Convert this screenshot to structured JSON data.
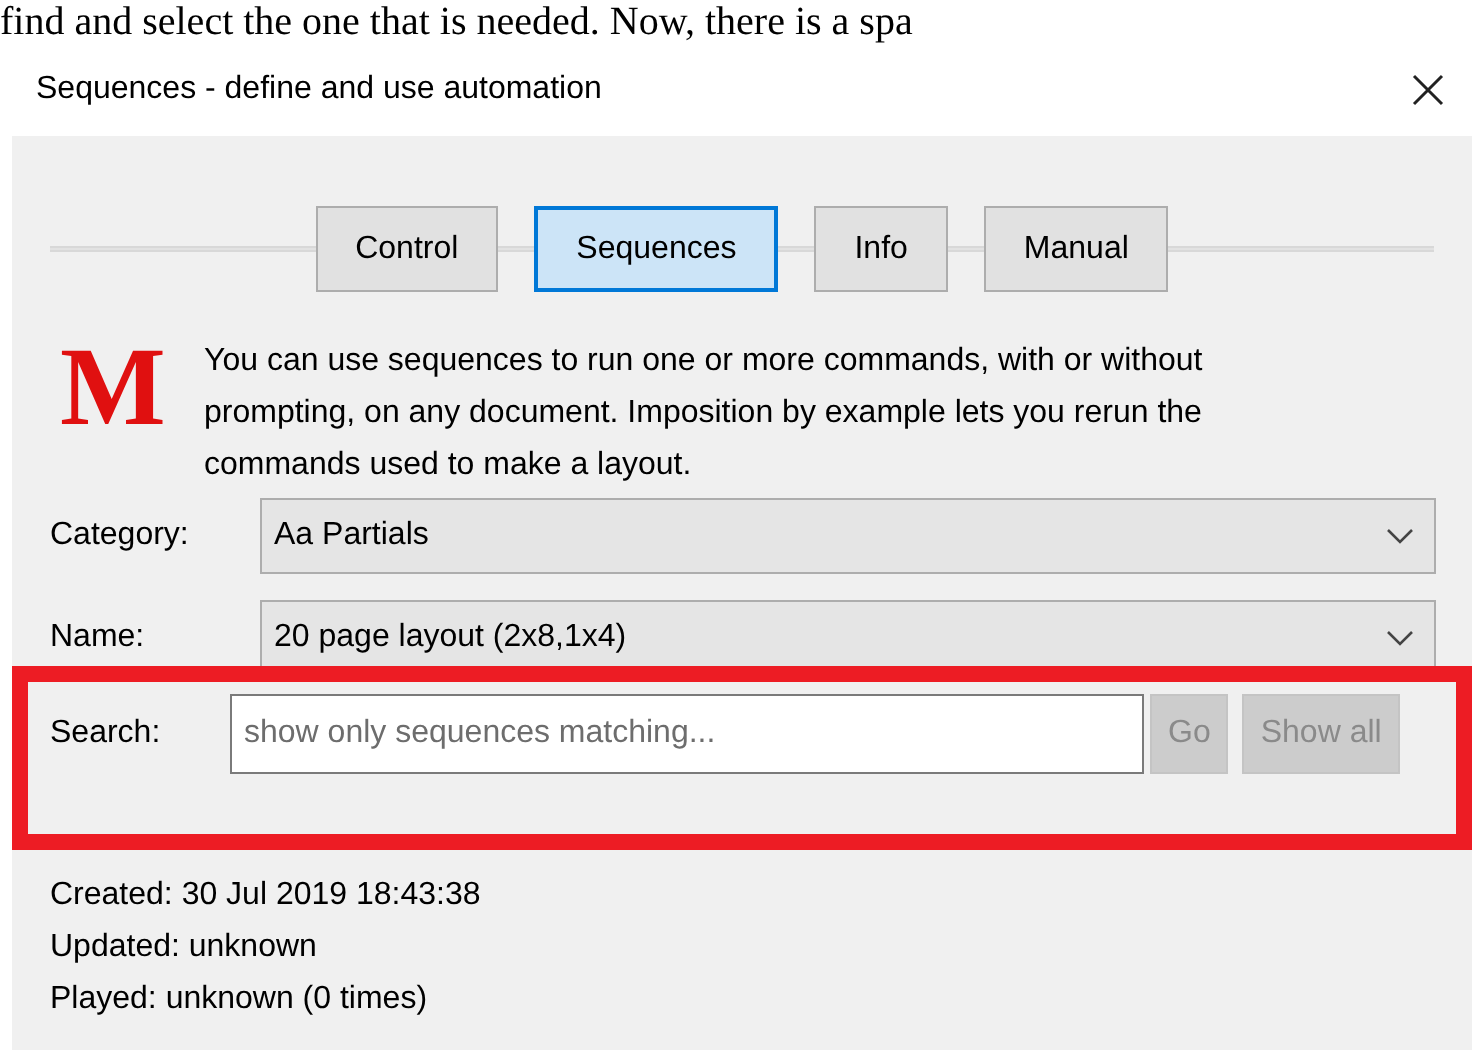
{
  "page_text": "find and select the one that is needed. Now, there is a spa",
  "window": {
    "title": "Sequences - define and use automation"
  },
  "tabs": [
    {
      "label": "Control",
      "selected": false
    },
    {
      "label": "Sequences",
      "selected": true
    },
    {
      "label": "Info",
      "selected": false
    },
    {
      "label": "Manual",
      "selected": false
    }
  ],
  "description": {
    "logo": "M",
    "text": "You can use sequences to run one or more commands, with or without prompting, on any document. Imposition by example lets you rerun the commands used to make a layout."
  },
  "fields": [
    {
      "kind": "dropdown",
      "label": "Category:",
      "value": "Aa Partials"
    },
    {
      "kind": "dropdown",
      "label": "Name:",
      "value": "20 page layout (2x8,1x4)"
    }
  ],
  "search": {
    "label": "Search:",
    "placeholder": "show only sequences matching...",
    "highlighted": true,
    "buttons": [
      {
        "label": "Go",
        "disabled": true
      },
      {
        "label": "Show all",
        "disabled": true
      }
    ]
  },
  "info": [
    "Created: 30 Jul 2019 18:43:38",
    "Updated: unknown",
    "Played: unknown (0 times)"
  ]
}
